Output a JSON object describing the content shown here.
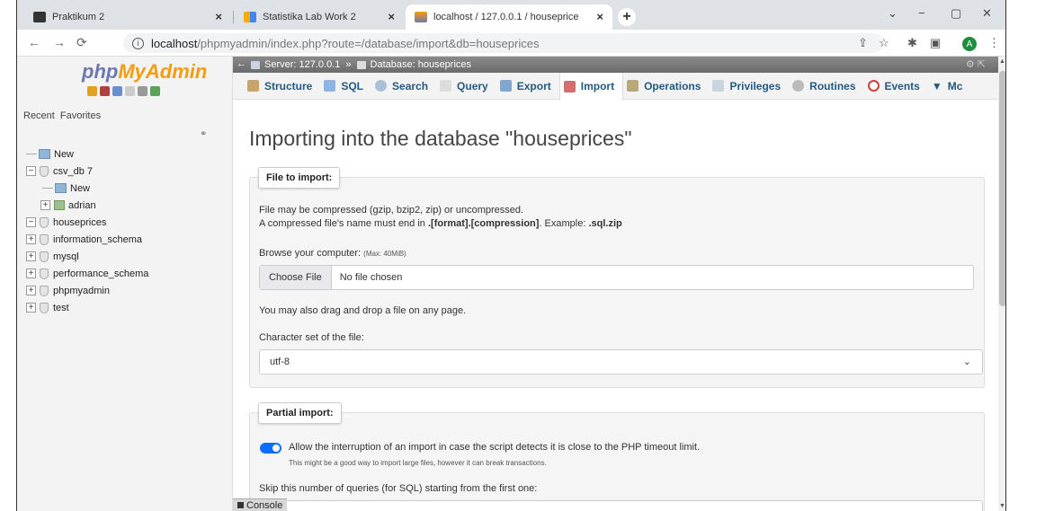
{
  "browser": {
    "tabs": [
      {
        "title": "Praktikum 2"
      },
      {
        "title": "Statistika Lab Work 2"
      },
      {
        "title": "localhost / 127.0.0.1 / houseprice"
      }
    ],
    "close_glyph": "×",
    "new_tab_glyph": "+",
    "window_controls": {
      "dropdown": "⌄",
      "minimize": "−",
      "restore": "▢",
      "close": "✕"
    },
    "url_host": "localhost",
    "url_path": "/phpmyadmin/index.php?route=/database/import&db=houseprices",
    "profile_initial": "A",
    "icons": [
      "back-icon",
      "forward-icon",
      "reload-icon",
      "share-icon",
      "star-icon",
      "extensions-icon",
      "sidepanel-icon",
      "menu-icon"
    ]
  },
  "sidebar": {
    "logo_php": "php",
    "logo_myadmin": "MyAdmin",
    "recent_label": "Recent",
    "favorites_label": "Favorites",
    "tree": {
      "new_root": "New",
      "csv_db": "csv_db 7",
      "csv_db_new": "New",
      "csv_db_table": "adrian",
      "houseprices": "houseprices",
      "information_schema": "information_schema",
      "mysql": "mysql",
      "performance_schema": "performance_schema",
      "phpmyadmin": "phpmyadmin",
      "test": "test"
    }
  },
  "breadcrumb": {
    "server": "Server: 127.0.0.1",
    "separator": "»",
    "database": "Database: houseprices"
  },
  "menu": {
    "structure": "Structure",
    "sql": "SQL",
    "search": "Search",
    "query": "Query",
    "export": "Export",
    "import": "Import",
    "operations": "Operations",
    "privileges": "Privileges",
    "routines": "Routines",
    "events": "Events",
    "more": "Mc"
  },
  "page": {
    "title": "Importing into the database \"houseprices\""
  },
  "file_import": {
    "legend": "File to import:",
    "line1": "File may be compressed (gzip, bzip2, zip) or uncompressed.",
    "line2_prefix": "A compressed file's name must end in ",
    "line2_bold": ".[format].[compression]",
    "line2_mid": ". Example: ",
    "line2_example": ".sql.zip",
    "browse_label": "Browse your computer: ",
    "browse_max": "(Max: 40MiB)",
    "choose_file": "Choose File",
    "no_file": "No file chosen",
    "drag_drop": "You may also drag and drop a file on any page.",
    "charset_label": "Character set of the file:",
    "charset_value": "utf-8"
  },
  "partial_import": {
    "legend": "Partial import:",
    "allow_interrupt": "Allow the interruption of an import in case the script detects it is close to the PHP timeout limit.",
    "allow_interrupt_hint": "This might be a good way to import large files, however it can break transactions.",
    "allow_interrupt_enabled": true,
    "skip_label": "Skip this number of queries (for SQL) starting from the first one:"
  },
  "console": {
    "label": "Console"
  },
  "colors": {
    "accent": "#235a81",
    "toggle": "#0d6efd",
    "logo_php": "#6c78af",
    "logo_myadmin": "#f89c0e"
  }
}
